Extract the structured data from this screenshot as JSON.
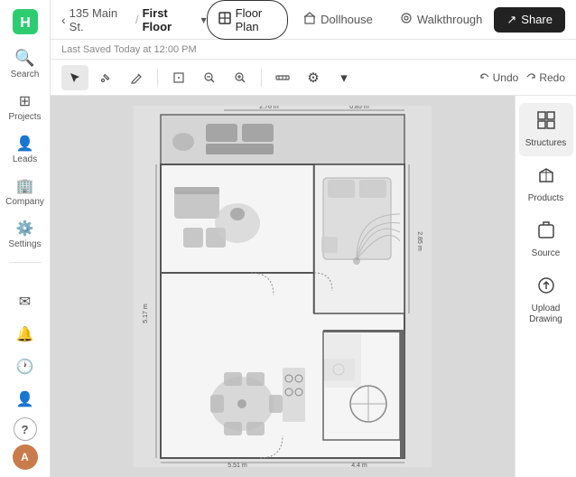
{
  "sidebar": {
    "logo_text": "H",
    "nav_items": [
      {
        "id": "search",
        "label": "Search",
        "icon": "🔍"
      },
      {
        "id": "projects",
        "label": "Projects",
        "icon": "⊞"
      },
      {
        "id": "leads",
        "label": "Leads",
        "icon": "👤"
      },
      {
        "id": "company",
        "label": "Company",
        "icon": "🏢"
      },
      {
        "id": "settings",
        "label": "Settings",
        "icon": "⚙️"
      }
    ],
    "bottom_items": [
      {
        "id": "mail",
        "icon": "✉"
      },
      {
        "id": "bell",
        "icon": "🔔"
      },
      {
        "id": "clock",
        "icon": "🕐"
      },
      {
        "id": "person",
        "icon": "👤"
      },
      {
        "id": "help",
        "icon": "?"
      }
    ],
    "avatar_initials": "A"
  },
  "topbar": {
    "back_arrow": "‹",
    "address": "135 Main St.",
    "separator": "/",
    "floor": "First Floor",
    "chevron": "▾",
    "tabs": [
      {
        "id": "floor-plan",
        "label": "Floor Plan",
        "icon": "⊡",
        "active": true
      },
      {
        "id": "dollhouse",
        "label": "Dollhouse",
        "icon": "⊟",
        "active": false
      },
      {
        "id": "walkthrough",
        "label": "Walkthrough",
        "icon": "◎",
        "active": false
      }
    ],
    "share_label": "Share",
    "share_icon": "↗"
  },
  "saved_bar": {
    "text": "Last Saved Today at 12:00 PM"
  },
  "toolbar": {
    "tools": [
      {
        "id": "select",
        "icon": "↖",
        "active": true
      },
      {
        "id": "edit",
        "icon": "✏"
      },
      {
        "id": "draw",
        "icon": "✒"
      },
      {
        "id": "room",
        "icon": "⬚"
      },
      {
        "id": "zoom-out",
        "icon": "−"
      },
      {
        "id": "zoom-in",
        "icon": "+"
      },
      {
        "id": "measure",
        "icon": "⊕"
      },
      {
        "id": "gear",
        "icon": "⚙"
      }
    ],
    "undo_label": "Undo",
    "redo_label": "Redo"
  },
  "right_panel": {
    "items": [
      {
        "id": "structures",
        "label": "Structures",
        "icon": "⊞",
        "active": true
      },
      {
        "id": "products",
        "label": "Products",
        "icon": "🪑"
      },
      {
        "id": "source",
        "label": "Source",
        "icon": "⊟"
      },
      {
        "id": "upload",
        "label": "Upload Drawing",
        "icon": "⊕"
      }
    ]
  }
}
